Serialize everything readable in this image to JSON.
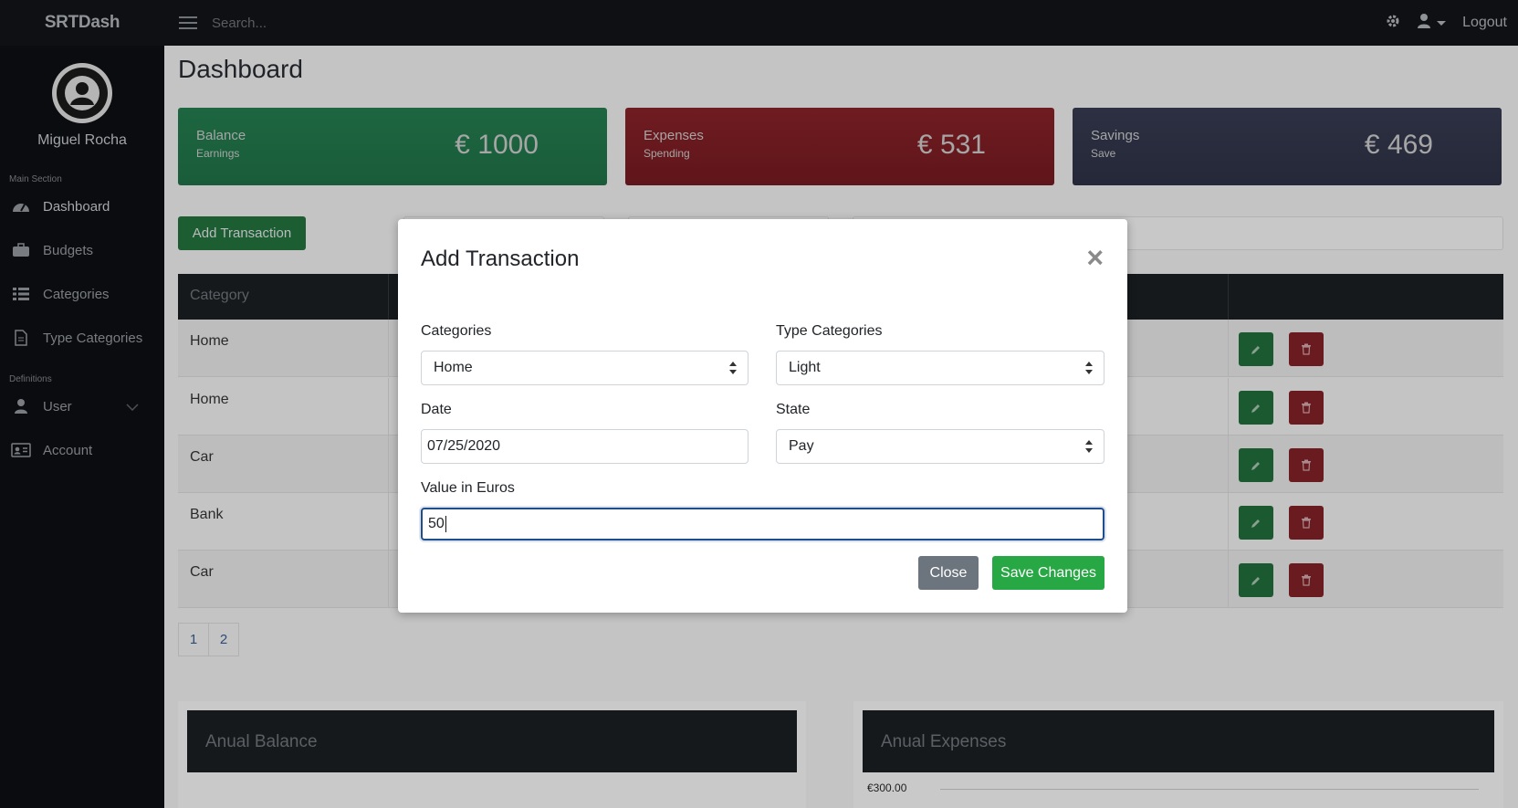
{
  "topbar": {
    "brand": "SRTDash",
    "search_placeholder": "Search...",
    "logout_label": "Logout"
  },
  "sidebar": {
    "user_name": "Miguel Rocha",
    "main_section_label": "Main Section",
    "definitions_label": "Definitions",
    "items": [
      {
        "label": "Dashboard",
        "icon": "dashboard-icon"
      },
      {
        "label": "Budgets",
        "icon": "briefcase-icon"
      },
      {
        "label": "Categories",
        "icon": "list-icon"
      },
      {
        "label": "Type Categories",
        "icon": "file-icon"
      },
      {
        "label": "User",
        "icon": "user-icon"
      },
      {
        "label": "Account",
        "icon": "id-card-icon"
      }
    ]
  },
  "main": {
    "page_title": "Dashboard",
    "cards": [
      {
        "label": "Balance",
        "sub": "Earnings",
        "value": "€ 1000"
      },
      {
        "label": "Expenses",
        "sub": "Spending",
        "value": "€ 531"
      },
      {
        "label": "Savings",
        "sub": "Save",
        "value": "€ 469"
      }
    ],
    "add_transaction_label": "Add Transaction",
    "table": {
      "header_category": "Category",
      "rows": [
        "Home",
        "Home",
        "Car",
        "Bank",
        "Car"
      ]
    },
    "pagination": [
      "1",
      "2"
    ],
    "panels": {
      "annual_balance": "Anual Balance",
      "annual_expenses": "Anual Expenses",
      "expenses_axis_top": "€300.00"
    }
  },
  "modal": {
    "title": "Add Transaction",
    "categories_label": "Categories",
    "categories_value": "Home",
    "type_categories_label": "Type Categories",
    "type_categories_value": "Light",
    "date_label": "Date",
    "date_value": "07/25/2020",
    "state_label": "State",
    "state_value": "Pay",
    "value_label": "Value in Euros",
    "value_value": "50",
    "close_label": "Close",
    "save_label": "Save Changes"
  },
  "colors": {
    "save_button": "#28a745",
    "close_button": "#6c757d",
    "focus_border": "#1f4e8c"
  }
}
